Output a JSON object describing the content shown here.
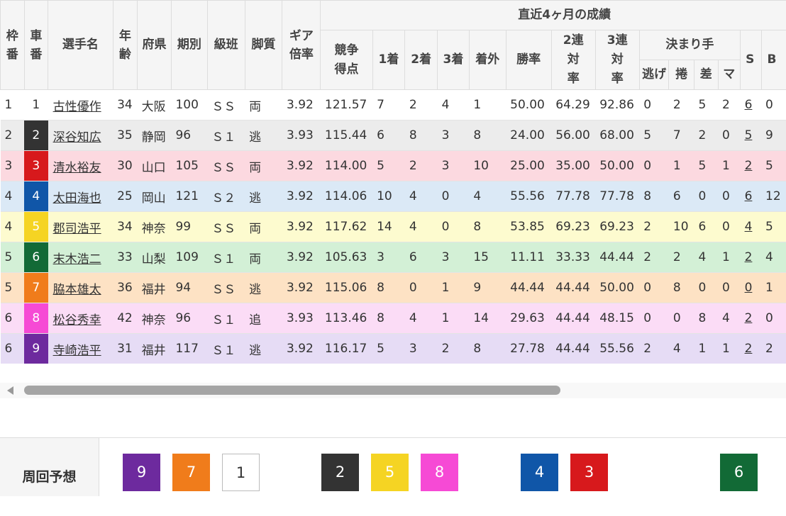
{
  "headers": {
    "waku": "枠番",
    "sha": "車番",
    "name": "選手名",
    "age": "年齢",
    "pref": "府県",
    "term": "期別",
    "grade": "級班",
    "style": "脚質",
    "gear": "ギア倍率",
    "recent_group": "直近4ヶ月の成績",
    "score": "競争得点",
    "first": "1着",
    "second": "2着",
    "third": "3着",
    "out": "着外",
    "win_rate": "勝率",
    "rate2": "2連対率",
    "rate3": "3連対率",
    "kimarite_group": "決まり手",
    "nige": "逃げ",
    "makuri": "捲",
    "sashi": "差",
    "mark": "マ",
    "s": "S",
    "b": "B"
  },
  "rows": [
    {
      "waku": "1",
      "bno": "1",
      "name": "古性優作",
      "age": "34",
      "pref": "大阪",
      "term": "100",
      "grade": "ＳＳ",
      "style": "両",
      "gear": "3.92",
      "score": "121.57",
      "c1": "7",
      "c2": "2",
      "c3": "4",
      "cout": "1",
      "win": "50.00",
      "r2": "64.29",
      "r3": "92.86",
      "nige": "0",
      "makuri": "2",
      "sashi": "5",
      "mark": "2",
      "s": "6",
      "b": "0"
    },
    {
      "waku": "2",
      "bno": "2",
      "name": "深谷知広",
      "age": "35",
      "pref": "静岡",
      "term": "96",
      "grade": "Ｓ１",
      "style": "逃",
      "gear": "3.93",
      "score": "115.44",
      "c1": "6",
      "c2": "8",
      "c3": "3",
      "cout": "8",
      "win": "24.00",
      "r2": "56.00",
      "r3": "68.00",
      "nige": "5",
      "makuri": "7",
      "sashi": "2",
      "mark": "0",
      "s": "5",
      "b": "9"
    },
    {
      "waku": "3",
      "bno": "3",
      "name": "清水裕友",
      "age": "30",
      "pref": "山口",
      "term": "105",
      "grade": "ＳＳ",
      "style": "両",
      "gear": "3.92",
      "score": "114.00",
      "c1": "5",
      "c2": "2",
      "c3": "3",
      "cout": "10",
      "win": "25.00",
      "r2": "35.00",
      "r3": "50.00",
      "nige": "0",
      "makuri": "1",
      "sashi": "5",
      "mark": "1",
      "s": "2",
      "b": "5"
    },
    {
      "waku": "4",
      "bno": "4",
      "name": "太田海也",
      "age": "25",
      "pref": "岡山",
      "term": "121",
      "grade": "Ｓ２",
      "style": "逃",
      "gear": "3.92",
      "score": "114.06",
      "c1": "10",
      "c2": "4",
      "c3": "0",
      "cout": "4",
      "win": "55.56",
      "r2": "77.78",
      "r3": "77.78",
      "nige": "8",
      "makuri": "6",
      "sashi": "0",
      "mark": "0",
      "s": "6",
      "b": "12"
    },
    {
      "waku": "4",
      "bno": "5",
      "name": "郡司浩平",
      "age": "34",
      "pref": "神奈",
      "term": "99",
      "grade": "ＳＳ",
      "style": "両",
      "gear": "3.92",
      "score": "117.62",
      "c1": "14",
      "c2": "4",
      "c3": "0",
      "cout": "8",
      "win": "53.85",
      "r2": "69.23",
      "r3": "69.23",
      "nige": "2",
      "makuri": "10",
      "sashi": "6",
      "mark": "0",
      "s": "4",
      "b": "5"
    },
    {
      "waku": "5",
      "bno": "6",
      "name": "末木浩二",
      "age": "33",
      "pref": "山梨",
      "term": "109",
      "grade": "Ｓ１",
      "style": "両",
      "gear": "3.92",
      "score": "105.63",
      "c1": "3",
      "c2": "6",
      "c3": "3",
      "cout": "15",
      "win": "11.11",
      "r2": "33.33",
      "r3": "44.44",
      "nige": "2",
      "makuri": "2",
      "sashi": "4",
      "mark": "1",
      "s": "2",
      "b": "4"
    },
    {
      "waku": "5",
      "bno": "7",
      "name": "脇本雄太",
      "age": "36",
      "pref": "福井",
      "term": "94",
      "grade": "ＳＳ",
      "style": "逃",
      "gear": "3.92",
      "score": "115.06",
      "c1": "8",
      "c2": "0",
      "c3": "1",
      "cout": "9",
      "win": "44.44",
      "r2": "44.44",
      "r3": "50.00",
      "nige": "0",
      "makuri": "8",
      "sashi": "0",
      "mark": "0",
      "s": "0",
      "b": "1"
    },
    {
      "waku": "6",
      "bno": "8",
      "name": "松谷秀幸",
      "age": "42",
      "pref": "神奈",
      "term": "96",
      "grade": "Ｓ１",
      "style": "追",
      "gear": "3.93",
      "score": "113.46",
      "c1": "8",
      "c2": "4",
      "c3": "1",
      "cout": "14",
      "win": "29.63",
      "r2": "44.44",
      "r3": "48.15",
      "nige": "0",
      "makuri": "0",
      "sashi": "8",
      "mark": "4",
      "s": "2",
      "b": "0"
    },
    {
      "waku": "6",
      "bno": "9",
      "name": "寺崎浩平",
      "age": "31",
      "pref": "福井",
      "term": "117",
      "grade": "Ｓ１",
      "style": "逃",
      "gear": "3.92",
      "score": "116.17",
      "c1": "5",
      "c2": "3",
      "c3": "2",
      "cout": "8",
      "win": "27.78",
      "r2": "44.44",
      "r3": "55.56",
      "nige": "2",
      "makuri": "4",
      "sashi": "1",
      "mark": "1",
      "s": "2",
      "b": "2"
    }
  ],
  "lap_prediction": {
    "label": "周回予想",
    "boxes": [
      "9",
      "7",
      "1",
      "2",
      "5",
      "8",
      "4",
      "3",
      "6"
    ]
  },
  "colors": {
    "bike1": "#ffffff",
    "bike2": "#333333",
    "bike3": "#d7191c",
    "bike4": "#1056a8",
    "bike5": "#f5d423",
    "bike6": "#126a36",
    "bike7": "#f07c1b",
    "bike8": "#f64ad5",
    "bike9": "#6d2a9e"
  }
}
